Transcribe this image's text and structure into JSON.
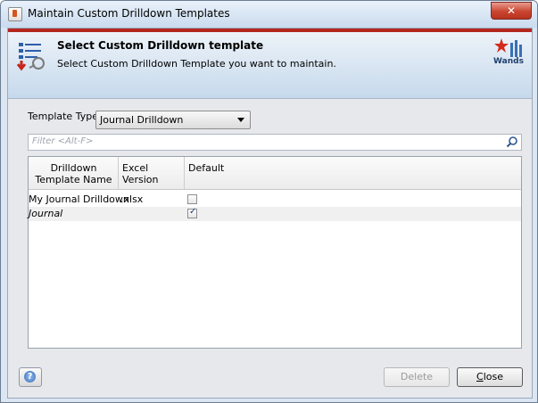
{
  "window": {
    "title": "Maintain Custom Drilldown Templates",
    "close_glyph": "✕"
  },
  "header": {
    "title": "Select Custom Drilldown template",
    "subtitle": "Select Custom Drilldown Template you want to maintain.",
    "logo_label": "Wands",
    "accent_color": "#b3271f"
  },
  "template_type": {
    "label": "Template Type",
    "selected": "Journal Drilldown"
  },
  "filter": {
    "placeholder": "Filter <Alt-F>"
  },
  "table": {
    "columns": [
      "Drilldown Template Name",
      "Excel Version",
      "Default"
    ],
    "rows": [
      {
        "name": "My Journal Drilldown",
        "excel_version": ".xlsx",
        "default": false,
        "italic": false
      },
      {
        "name": "Journal",
        "excel_version": "",
        "default": true,
        "italic": true
      }
    ]
  },
  "footer": {
    "help_glyph": "?",
    "delete_label": "Delete",
    "close_label_first": "C",
    "close_label_rest": "lose"
  },
  "icons": [
    "app-icon",
    "template-list-icon",
    "wands-logo-icon",
    "search-icon",
    "help-icon",
    "checkbox-icon"
  ]
}
